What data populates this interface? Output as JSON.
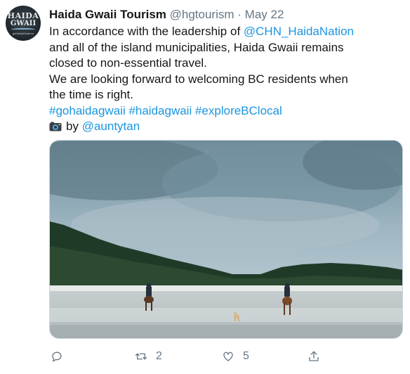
{
  "tweet": {
    "display_name": "Haida Gwaii Tourism",
    "handle": "@hgtourism",
    "separator": "·",
    "date": "May 22",
    "avatar": {
      "line1": "HAIDA",
      "line2": "GWAII",
      "site": "goHaidaGwaii.ca"
    },
    "body": {
      "line1_text": "In accordance with the leadership of ",
      "line1_mention": "@CHN_HaidaNation",
      "line2": "and all of the island municipalities, Haida Gwaii remains",
      "line3": "closed to non-essential travel.",
      "line4": "We are looking forward to welcoming BC residents when",
      "line5": "the time is right.",
      "hashtags": [
        "#gohaidagwaii",
        "#haidagwaii",
        "#exploreBClocal"
      ],
      "credit_by": "by",
      "credit_handle": "@auntytan"
    },
    "media": {
      "alt": "Two horseback riders and a dog on a beach with forest and cloudy sky"
    },
    "actions": {
      "reply_icon": "reply-icon",
      "retweet_icon": "retweet-icon",
      "retweet_count": "2",
      "like_icon": "heart-icon",
      "like_count": "5",
      "share_icon": "share-icon"
    },
    "colors": {
      "link": "#1b95e0",
      "secondary": "#657786",
      "text": "#14171a"
    }
  }
}
